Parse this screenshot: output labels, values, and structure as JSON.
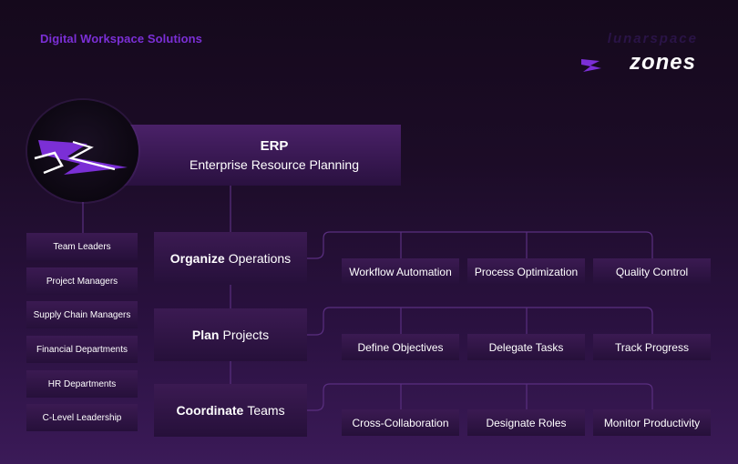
{
  "header": {
    "tagline": "Digital Workspace Solutions",
    "brand_top": "LunarSpace",
    "brand_main": "Zones"
  },
  "colors": {
    "accent": "#7b2fd6",
    "box_top": "#3b1a52",
    "line": "#5a2f80"
  },
  "erp": {
    "title": "ERP",
    "subtitle": "Enterprise Resource Planning"
  },
  "audiences": [
    "Team Leaders",
    "Project Managers",
    "Supply Chain Managers",
    "Financial Departments",
    "HR Departments",
    "C-Level Leadership"
  ],
  "functions": [
    {
      "bold": "Organize",
      "rest": "Operations",
      "tasks": [
        "Workflow Automation",
        "Process Optimization",
        "Quality Control"
      ]
    },
    {
      "bold": "Plan",
      "rest": "Projects",
      "tasks": [
        "Define Objectives",
        "Delegate Tasks",
        "Track Progress"
      ]
    },
    {
      "bold": "Coordinate",
      "rest": "Teams",
      "tasks": [
        "Cross-Collaboration",
        "Designate Roles",
        "Monitor Productivity"
      ]
    }
  ]
}
